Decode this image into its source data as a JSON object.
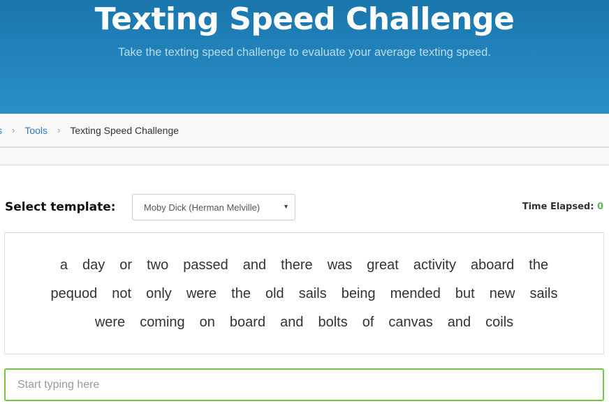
{
  "header": {
    "title": "Texting Speed Challenge",
    "subtitle": "Take the texting speed challenge to evaluate your average texting speed."
  },
  "breadcrumb": {
    "items": [
      "s",
      "Tools",
      "Texting Speed Challenge"
    ],
    "separator": "›"
  },
  "controls": {
    "select_label": "Select template:",
    "selected_template": "Moby Dick (Herman Melville)",
    "caret": "▼",
    "time_label": "Time Elapsed: ",
    "time_value": "0"
  },
  "passage": {
    "lines": [
      [
        "a",
        "day",
        "or",
        "two",
        "passed",
        "and",
        "there",
        "was",
        "great",
        "activity",
        "aboard",
        "the"
      ],
      [
        "pequod",
        "not",
        "only",
        "were",
        "the",
        "old",
        "sails",
        "being",
        "mended",
        "but",
        "new",
        "sails"
      ],
      [
        "were",
        "coming",
        "on",
        "board",
        "and",
        "bolts",
        "of",
        "canvas",
        "and",
        "coils"
      ]
    ]
  },
  "input": {
    "placeholder": "Start typing here",
    "value": ""
  },
  "colors": {
    "accent": "#2a8fc7",
    "success": "#5cb85c",
    "input_border": "#7ac142"
  }
}
